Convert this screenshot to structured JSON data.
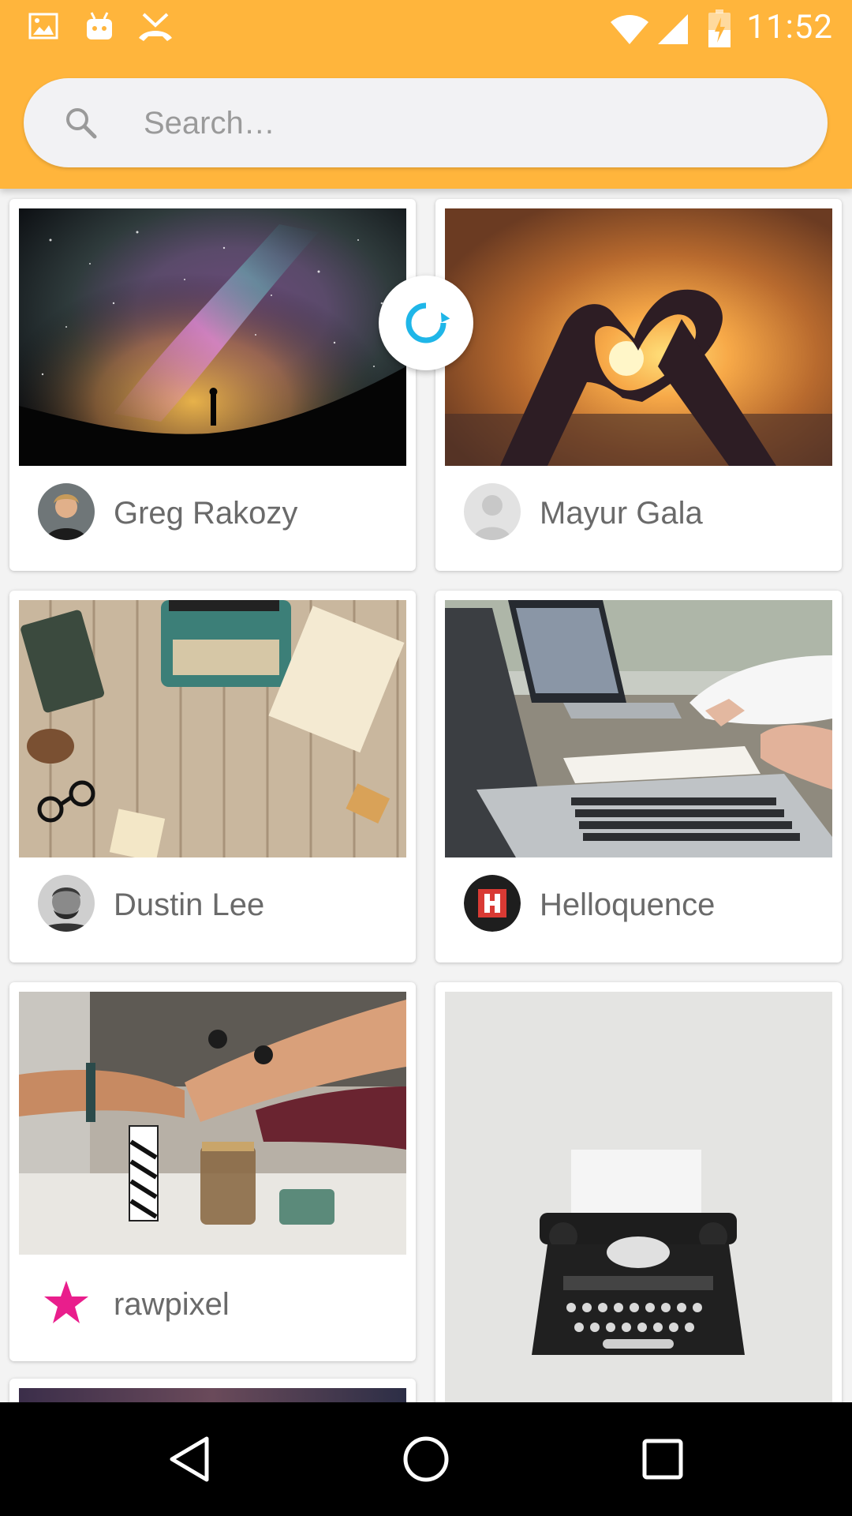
{
  "status_bar": {
    "time": "11:52",
    "icons": [
      "image-icon",
      "android-icon",
      "missed-call-icon",
      "wifi-icon",
      "signal-icon",
      "battery-charging-icon"
    ]
  },
  "search": {
    "placeholder": "Search…",
    "value": ""
  },
  "cards": [
    {
      "author": "Greg Rakozy",
      "photo": "starry-sky-silhouette",
      "avatar": "person-photo"
    },
    {
      "author": "Mayur Gala",
      "photo": "heart-hands-sunset",
      "avatar": "default-avatar"
    },
    {
      "author": "Dustin Lee",
      "photo": "typewriter-on-wood-desk",
      "avatar": "person-photo"
    },
    {
      "author": "Helloquence",
      "photo": "laptops-meeting",
      "avatar": "brand-logo-h"
    },
    {
      "author": "rawpixel",
      "photo": "team-hands-together",
      "avatar": "pink-star"
    },
    {
      "author": "",
      "photo": "vintage-typewriter-white"
    }
  ],
  "refresh_indicator": {
    "icon": "refresh-icon"
  },
  "navigation": {
    "buttons": [
      "back-icon",
      "home-icon",
      "recents-icon"
    ]
  },
  "colors": {
    "accent": "#ffb53c",
    "refresh": "#1fb6e8",
    "star": "#e91e8c"
  }
}
